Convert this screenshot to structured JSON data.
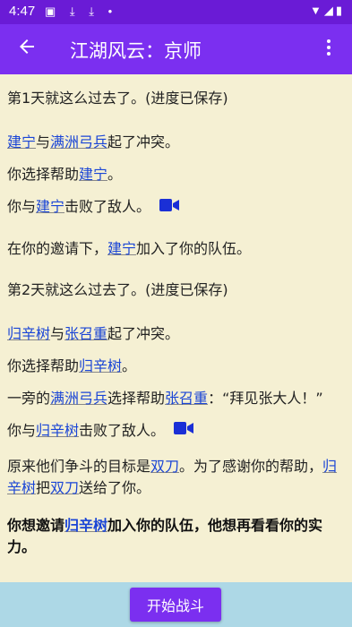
{
  "status_bar": {
    "time": "4:47"
  },
  "app_bar": {
    "title": "江湖风云：京师"
  },
  "story": {
    "p1": "第1天就这么过去了。(进度已保存)",
    "p2": {
      "a": "建宁",
      "b": "与",
      "c": "满洲弓兵",
      "d": "起了冲突。"
    },
    "p3": {
      "a": "你选择帮助",
      "b": "建宁",
      "c": "。"
    },
    "p4": {
      "a": "你与",
      "b": "建宁",
      "c": "击败了敌人。"
    },
    "p5": {
      "a": "在你的邀请下，",
      "b": "建宁",
      "c": "加入了你的队伍。"
    },
    "p6": "第2天就这么过去了。(进度已保存)",
    "p7": {
      "a": "归辛树",
      "b": "与",
      "c": "张召重",
      "d": "起了冲突。"
    },
    "p8": {
      "a": "你选择帮助",
      "b": "归辛树",
      "c": "。"
    },
    "p9": {
      "a": "一旁的",
      "b": "满洲弓兵",
      "c": "选择帮助",
      "d": "张召重",
      "e": "：“拜见张大人！”"
    },
    "p10": {
      "a": "你与",
      "b": "归辛树",
      "c": "击败了敌人。"
    },
    "p11": {
      "a": "原来他们争斗的目标是",
      "b": "双刀",
      "c": "。为了感谢你的帮助，",
      "d": "归辛树",
      "e": "把",
      "f": "双刀",
      "g": "送给了你。"
    },
    "p12": {
      "a": "你想邀请",
      "b": "归辛树",
      "c": "加入你的队伍，他想再看看你的实力。"
    }
  },
  "actions": {
    "start_fight": "开始战斗"
  },
  "colors": {
    "status_bar": "#6a1bd6",
    "app_bar": "#7b2ff0",
    "link": "#1a45d6",
    "background": "#f5f0d3",
    "bottom_bar": "#add8e6"
  }
}
